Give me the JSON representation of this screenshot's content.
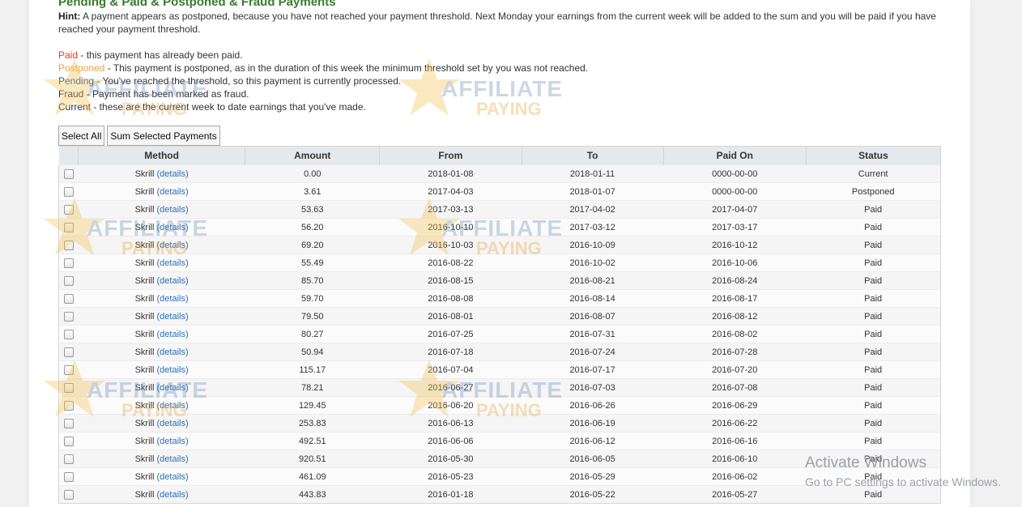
{
  "page": {
    "title": "Pending & Paid & Postponed & Fraud Payments",
    "hint_label": "Hint:",
    "hint_text": "A payment appears as postponed, because you have not reached your payment threshold. Next Monday your earnings from the current week will be added to the sum and you will be paid if you have reached your payment threshold."
  },
  "legend": [
    {
      "term": "Paid",
      "desc": " - this payment has already been paid."
    },
    {
      "term": "Postponed",
      "desc": " - This payment is postponed, as in the duration of this week the minimum threshold set by you was not reached."
    },
    {
      "term": "Pending",
      "desc": " - You've reached the threshold, so this payment is currently processed."
    },
    {
      "term": "Fraud",
      "desc": " - Payment has been marked as fraud."
    },
    {
      "term": "Current",
      "desc": " - these are the current week to date earnings that you've made."
    }
  ],
  "buttons": {
    "select_all": "Select All",
    "sum_selected": "Sum Selected Payments"
  },
  "table": {
    "headers": [
      "Method",
      "Amount",
      "From",
      "To",
      "Paid On",
      "Status"
    ],
    "details_label": "(details)",
    "rows": [
      {
        "method": "Skrill",
        "amount": "0.00",
        "from": "2018-01-08",
        "to": "2018-01-11",
        "paid_on": "0000-00-00",
        "status": "Current"
      },
      {
        "method": "Skrill",
        "amount": "3.61",
        "from": "2017-04-03",
        "to": "2018-01-07",
        "paid_on": "0000-00-00",
        "status": "Postponed"
      },
      {
        "method": "Skrill",
        "amount": "53.63",
        "from": "2017-03-13",
        "to": "2017-04-02",
        "paid_on": "2017-04-07",
        "status": "Paid"
      },
      {
        "method": "Skrill",
        "amount": "56.20",
        "from": "2016-10-10",
        "to": "2017-03-12",
        "paid_on": "2017-03-17",
        "status": "Paid"
      },
      {
        "method": "Skrill",
        "amount": "69.20",
        "from": "2016-10-03",
        "to": "2016-10-09",
        "paid_on": "2016-10-12",
        "status": "Paid"
      },
      {
        "method": "Skrill",
        "amount": "55.49",
        "from": "2016-08-22",
        "to": "2016-10-02",
        "paid_on": "2016-10-06",
        "status": "Paid"
      },
      {
        "method": "Skrill",
        "amount": "85.70",
        "from": "2016-08-15",
        "to": "2016-08-21",
        "paid_on": "2016-08-24",
        "status": "Paid"
      },
      {
        "method": "Skrill",
        "amount": "59.70",
        "from": "2016-08-08",
        "to": "2016-08-14",
        "paid_on": "2016-08-17",
        "status": "Paid"
      },
      {
        "method": "Skrill",
        "amount": "79.50",
        "from": "2016-08-01",
        "to": "2016-08-07",
        "paid_on": "2016-08-12",
        "status": "Paid"
      },
      {
        "method": "Skrill",
        "amount": "80.27",
        "from": "2016-07-25",
        "to": "2016-07-31",
        "paid_on": "2016-08-02",
        "status": "Paid"
      },
      {
        "method": "Skrill",
        "amount": "50.94",
        "from": "2016-07-18",
        "to": "2016-07-24",
        "paid_on": "2016-07-28",
        "status": "Paid"
      },
      {
        "method": "Skrill",
        "amount": "115.17",
        "from": "2016-07-04",
        "to": "2016-07-17",
        "paid_on": "2016-07-20",
        "status": "Paid"
      },
      {
        "method": "Skrill",
        "amount": "78.21",
        "from": "2016-06-27",
        "to": "2016-07-03",
        "paid_on": "2016-07-08",
        "status": "Paid"
      },
      {
        "method": "Skrill",
        "amount": "129.45",
        "from": "2016-06-20",
        "to": "2016-06-26",
        "paid_on": "2016-06-29",
        "status": "Paid"
      },
      {
        "method": "Skrill",
        "amount": "253.83",
        "from": "2016-06-13",
        "to": "2016-06-19",
        "paid_on": "2016-06-22",
        "status": "Paid"
      },
      {
        "method": "Skrill",
        "amount": "492.51",
        "from": "2016-06-06",
        "to": "2016-06-12",
        "paid_on": "2016-06-16",
        "status": "Paid"
      },
      {
        "method": "Skrill",
        "amount": "920.51",
        "from": "2016-05-30",
        "to": "2016-06-05",
        "paid_on": "2016-06-10",
        "status": "Paid"
      },
      {
        "method": "Skrill",
        "amount": "461.09",
        "from": "2016-05-23",
        "to": "2016-05-29",
        "paid_on": "2016-06-02",
        "status": "Paid"
      },
      {
        "method": "Skrill",
        "amount": "443.83",
        "from": "2016-01-18",
        "to": "2016-05-22",
        "paid_on": "2016-05-27",
        "status": "Paid"
      }
    ]
  },
  "watermark": {
    "line1": "AFFILIATE",
    "line2": "PAYING"
  },
  "os_overlay": {
    "line1": "Activate Windows",
    "line2": "Go to PC settings to activate Windows."
  },
  "colors": {
    "title_green": "#3a7a2d",
    "paid_red": "#e8141c",
    "postponed_orange": "#e8552a",
    "current_green": "#3a7a2d",
    "link_blue": "#2a6fb8"
  }
}
